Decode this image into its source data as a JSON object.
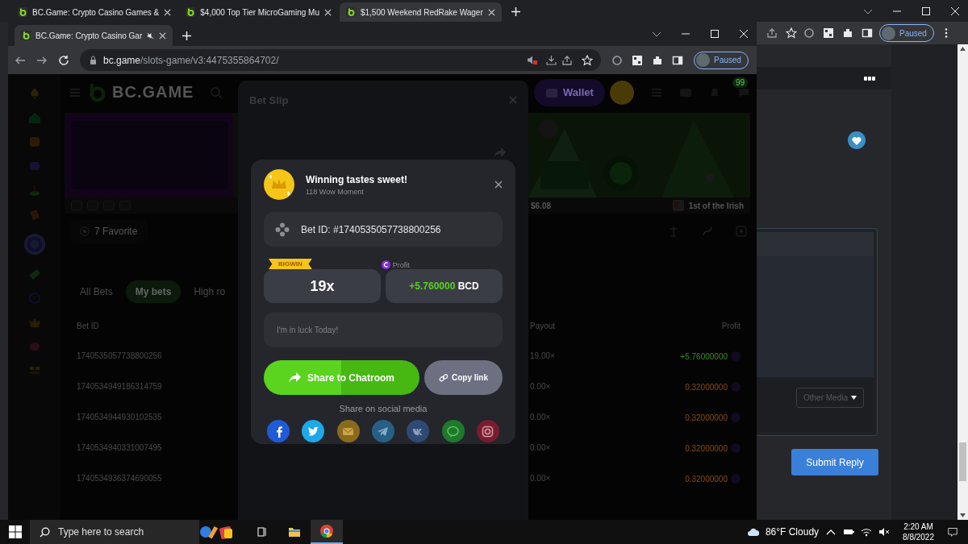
{
  "browser_tabs": [
    {
      "title": "BC.Game: Crypto Casino Games &",
      "selected": false
    },
    {
      "title": "$4,000 Top Tier MicroGaming Mu",
      "selected": false
    },
    {
      "title": "$1,500 Weekend RedRake Wager",
      "selected": true
    }
  ],
  "outer_toolbar": {
    "profile": "Paused"
  },
  "inner_window": {
    "tab_title": "BC.Game: Crypto Casino Gar",
    "url_host": "bc.game",
    "url_path": "/slots-game/v3:4475355864702/",
    "profile": "Paused"
  },
  "site": {
    "logo": "BC.GAME",
    "wallet": "Wallet",
    "notification_count": "99",
    "game_price": "$6.08",
    "game_name": "1st of the Irish",
    "favorite": "7 Favorite",
    "bet_tabs": [
      {
        "label": "All Bets",
        "selected": false
      },
      {
        "label": "My bets",
        "selected": true
      },
      {
        "label": "High ro",
        "selected": false
      }
    ],
    "columns": [
      "Bet ID",
      "Payout",
      "Profit"
    ],
    "rows": [
      {
        "bet_id": "1740535057738800256",
        "payout": "19.00×",
        "profit": "+5.76000000",
        "win": true
      },
      {
        "bet_id": "1740534949186314759",
        "payout": "0.00×",
        "profit": "0.32000000",
        "win": false
      },
      {
        "bet_id": "1740534944930102535",
        "payout": "0.00×",
        "profit": "0.32000000",
        "win": false
      },
      {
        "bet_id": "1740534940331007495",
        "payout": "0.00×",
        "profit": "0.32000000",
        "win": false
      },
      {
        "bet_id": "1740534936374690055",
        "payout": "0.00×",
        "profit": "0.32000000",
        "win": false
      }
    ]
  },
  "bet_slip": {
    "title": "Bet Slip"
  },
  "share_dialog": {
    "title": "Winning tastes sweet!",
    "subtitle": "118 Wow Moment",
    "bet_id": "Bet ID: #1740535057738800256",
    "badge": "BIGWIN",
    "multiplier": "19x",
    "profit_label": "Profit",
    "profit_amount": "+5.760000",
    "currency": "BCD",
    "message_placeholder": "I'm in luck Today!",
    "share_button": "Share to Chatroom",
    "copy_button": "Copy link",
    "social_label": "Share on social media",
    "social": [
      {
        "kind": "facebook",
        "color": "#1f5bd8"
      },
      {
        "kind": "twitter",
        "color": "#1ea8e8"
      },
      {
        "kind": "email",
        "color": "#8a6a1c"
      },
      {
        "kind": "telegram",
        "color": "#285f84"
      },
      {
        "kind": "vk",
        "color": "#2e4a72"
      },
      {
        "kind": "line",
        "color": "#1e7a2a"
      },
      {
        "kind": "instagram",
        "color": "#7a1c30"
      }
    ]
  },
  "forum": {
    "dropdown": "Other Media",
    "submit": "Submit Reply"
  },
  "taskbar": {
    "search_placeholder": "Type here to search",
    "weather": "86°F Cloudy",
    "time": "2:20 AM",
    "date": "8/8/2022"
  }
}
